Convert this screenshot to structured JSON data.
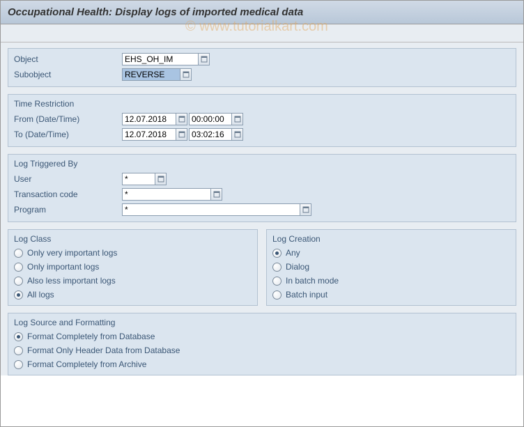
{
  "title": "Occupational Health: Display logs of imported medical data",
  "watermark": "© www.tutorialkart.com",
  "basic": {
    "objectLabel": "Object",
    "objectValue": "EHS_OH_IM",
    "subobjectLabel": "Subobject",
    "subobjectValue": "REVERSE"
  },
  "time": {
    "title": "Time Restriction",
    "fromLabel": "From (Date/Time)",
    "fromDate": "12.07.2018",
    "fromTime": "00:00:00",
    "toLabel": "To (Date/Time)",
    "toDate": "12.07.2018",
    "toTime": "03:02:16"
  },
  "triggered": {
    "title": "Log Triggered By",
    "userLabel": "User",
    "userValue": "*",
    "tcodeLabel": "Transaction code",
    "tcodeValue": "*",
    "programLabel": "Program",
    "programValue": "*"
  },
  "logClass": {
    "title": "Log Class",
    "options": [
      {
        "label": "Only very important logs",
        "checked": false
      },
      {
        "label": "Only important logs",
        "checked": false
      },
      {
        "label": "Also less important logs",
        "checked": false
      },
      {
        "label": "All logs",
        "checked": true
      }
    ]
  },
  "logCreation": {
    "title": "Log Creation",
    "options": [
      {
        "label": "Any",
        "checked": true
      },
      {
        "label": "Dialog",
        "checked": false
      },
      {
        "label": "In batch mode",
        "checked": false
      },
      {
        "label": "Batch input",
        "checked": false
      }
    ]
  },
  "source": {
    "title": "Log Source and Formatting",
    "options": [
      {
        "label": "Format Completely from Database",
        "checked": true
      },
      {
        "label": "Format Only Header Data from Database",
        "checked": false
      },
      {
        "label": "Format Completely from Archive",
        "checked": false
      }
    ]
  }
}
